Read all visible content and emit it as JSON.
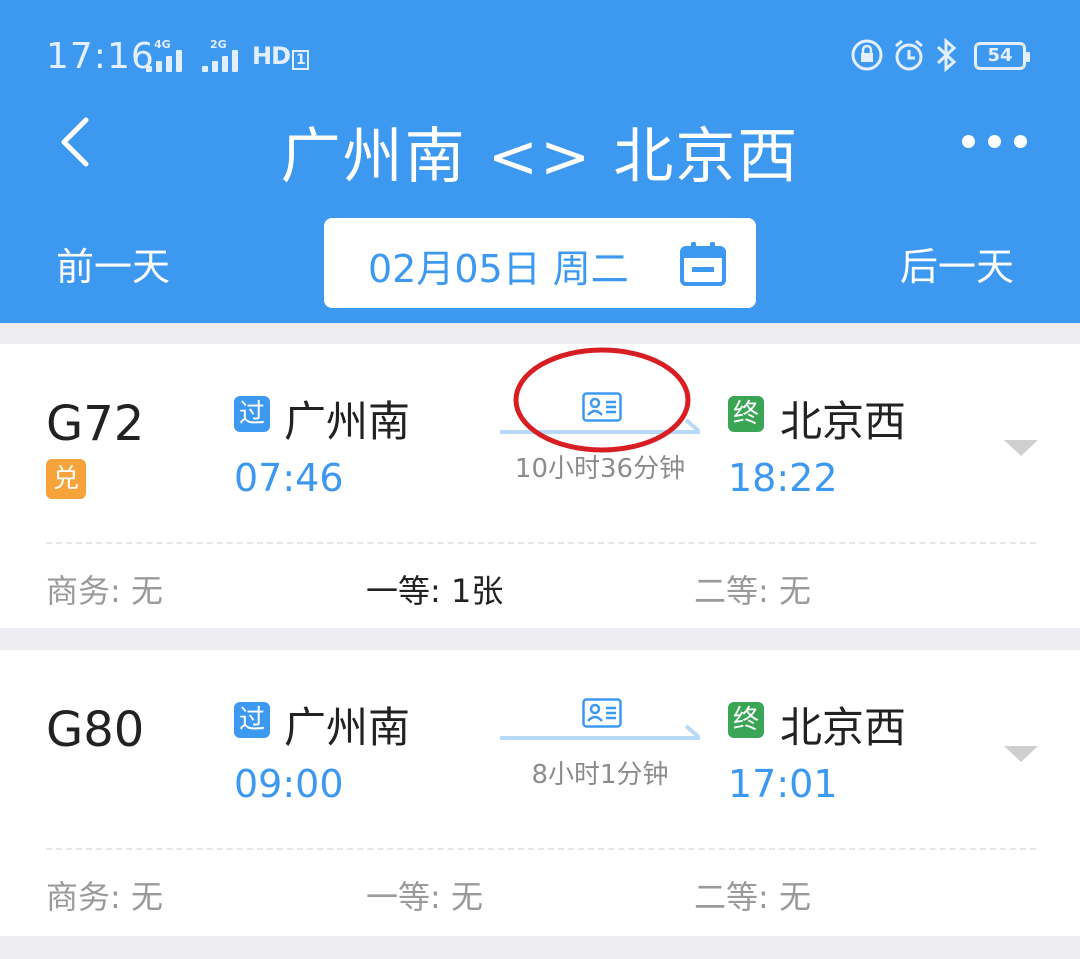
{
  "status_bar": {
    "time": "17:16",
    "network1": "4G",
    "network2": "2G",
    "hd": "HD",
    "hd_sub": "1",
    "battery": "54",
    "icons": [
      "lock-rotation-icon",
      "alarm-icon",
      "bluetooth-icon",
      "battery-icon"
    ]
  },
  "header": {
    "title": "广州南 <> 北京西",
    "prev_day": "前一天",
    "next_day": "后一天",
    "date": "02月05日 周二",
    "accent": "#3d98f0"
  },
  "trains": [
    {
      "train_no": "G72",
      "badge": "兑",
      "pass_tag": "过",
      "from": "广州南",
      "dep_time": "07:46",
      "duration": "10小时36分钟",
      "end_tag": "终",
      "to": "北京西",
      "arr_time": "18:22",
      "seats": {
        "business": "商务: 无",
        "first": "一等: 1张",
        "second": "二等: 无"
      }
    },
    {
      "train_no": "G80",
      "pass_tag": "过",
      "from": "广州南",
      "dep_time": "09:00",
      "duration": "8小时1分钟",
      "end_tag": "终",
      "to": "北京西",
      "arr_time": "17:01",
      "seats": {
        "business": "商务: 无",
        "first": "一等: 无",
        "second": "二等: 无"
      }
    }
  ],
  "colors": {
    "blue": "#3d98f0",
    "green": "#3aa655",
    "orange": "#f5a33a",
    "annotation_red": "#d81e22"
  }
}
